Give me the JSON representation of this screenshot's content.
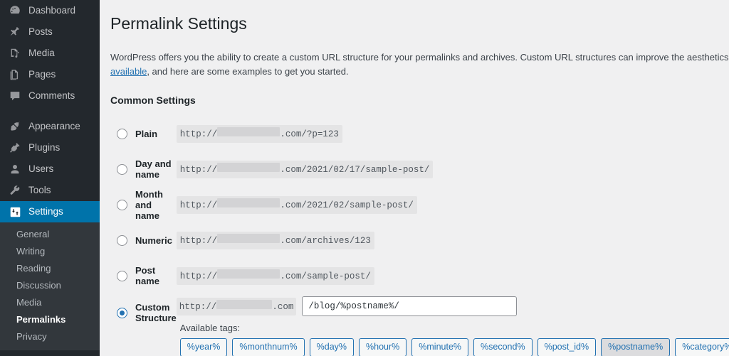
{
  "sidebar": {
    "items": [
      {
        "label": "Dashboard",
        "icon": "dashboard-icon",
        "current": false
      },
      {
        "label": "Posts",
        "icon": "pin-icon",
        "current": false
      },
      {
        "label": "Media",
        "icon": "media-icon",
        "current": false
      },
      {
        "label": "Pages",
        "icon": "pages-icon",
        "current": false
      },
      {
        "label": "Comments",
        "icon": "comments-icon",
        "current": false
      },
      {
        "label": "Appearance",
        "icon": "appearance-brush-icon",
        "current": false
      },
      {
        "label": "Plugins",
        "icon": "plugins-plug-icon",
        "current": false
      },
      {
        "label": "Users",
        "icon": "users-icon",
        "current": false
      },
      {
        "label": "Tools",
        "icon": "tools-wrench-icon",
        "current": false
      },
      {
        "label": "Settings",
        "icon": "settings-sliders-icon",
        "current": true
      }
    ],
    "submenu": [
      {
        "label": "General",
        "current": false
      },
      {
        "label": "Writing",
        "current": false
      },
      {
        "label": "Reading",
        "current": false
      },
      {
        "label": "Discussion",
        "current": false
      },
      {
        "label": "Media",
        "current": false
      },
      {
        "label": "Permalinks",
        "current": true
      },
      {
        "label": "Privacy",
        "current": false
      }
    ]
  },
  "page": {
    "title": "Permalink Settings",
    "intro_line1_before_link": "WordPress offers you the ability to create a custom URL structure for your permalinks and archives. Custom URL structures can improve the aesthetics, usability, and forward-c",
    "intro_link_text": "available",
    "intro_line2_after_link": ", and here are some examples to get you started.",
    "section_title": "Common Settings"
  },
  "options": [
    {
      "label": "Plain",
      "selected": false,
      "example_prefix": "http://",
      "example_redacted_width": 88,
      "example_suffix": ".com/?p=123"
    },
    {
      "label": "Day and name",
      "selected": false,
      "example_prefix": "http://",
      "example_redacted_width": 88,
      "example_suffix": ".com/2021/02/17/sample-post/"
    },
    {
      "label": "Month and name",
      "selected": false,
      "example_prefix": "http://",
      "example_redacted_width": 88,
      "example_suffix": ".com/2021/02/sample-post/"
    },
    {
      "label": "Numeric",
      "selected": false,
      "example_prefix": "http://",
      "example_redacted_width": 88,
      "example_suffix": ".com/archives/123"
    },
    {
      "label": "Post name",
      "selected": false,
      "example_prefix": "http://",
      "example_redacted_width": 88,
      "example_suffix": ".com/sample-post/"
    }
  ],
  "custom_structure": {
    "label": "Custom Structure",
    "selected": true,
    "prefix_text": "http://",
    "prefix_redacted_width": 78,
    "prefix_suffix": ".com",
    "input_value": "/blog/%postname%/",
    "input_placeholder": "",
    "available_tags_label": "Available tags:",
    "tags": [
      {
        "label": "%year%",
        "active": false
      },
      {
        "label": "%monthnum%",
        "active": false
      },
      {
        "label": "%day%",
        "active": false
      },
      {
        "label": "%hour%",
        "active": false
      },
      {
        "label": "%minute%",
        "active": false
      },
      {
        "label": "%second%",
        "active": false
      },
      {
        "label": "%post_id%",
        "active": false
      },
      {
        "label": "%postname%",
        "active": true
      },
      {
        "label": "%category%",
        "active": false
      }
    ]
  },
  "colors": {
    "sidebar_bg": "#23282d",
    "submenu_bg": "#32373c",
    "accent": "#0073aa",
    "link": "#2271b1",
    "page_bg": "#f0f0f1",
    "code_bg": "#e4e4e5"
  }
}
